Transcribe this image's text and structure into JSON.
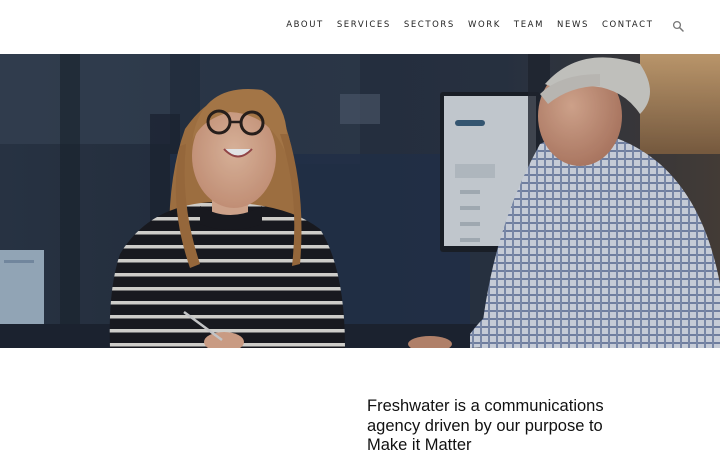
{
  "nav": {
    "items": [
      {
        "label": "ABOUT"
      },
      {
        "label": "SERVICES"
      },
      {
        "label": "SECTORS"
      },
      {
        "label": "WORK"
      },
      {
        "label": "TEAM"
      },
      {
        "label": "NEWS"
      },
      {
        "label": "CONTACT"
      }
    ],
    "search_icon": "search-icon"
  },
  "hero": {
    "image": "photo of two people talking at an office desk"
  },
  "intro": {
    "text": "Freshwater is a communications agency driven by our purpose to Make it Matter"
  }
}
